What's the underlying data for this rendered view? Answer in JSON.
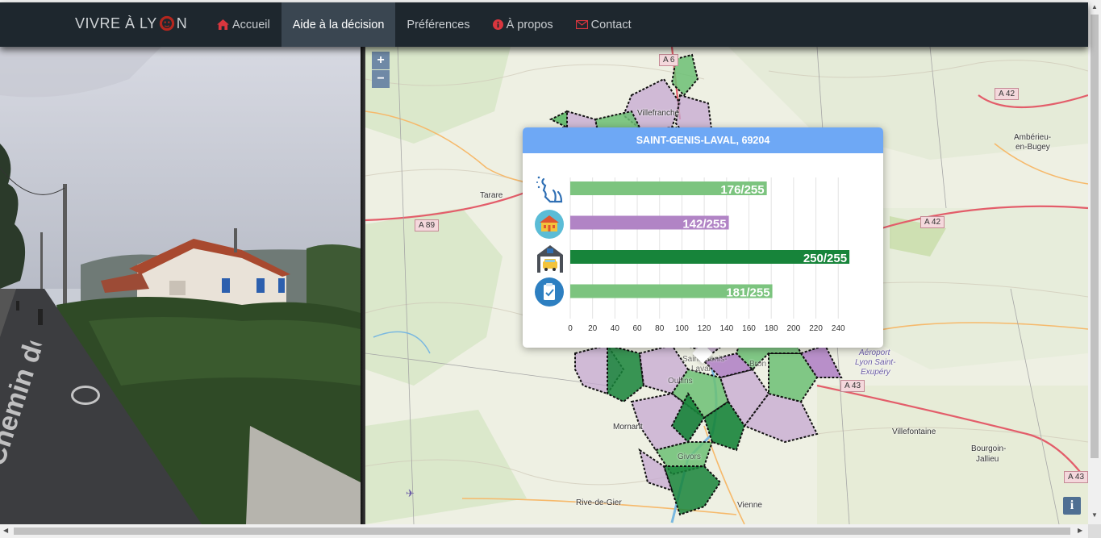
{
  "navbar": {
    "brand_prefix": "VIVRE À LY",
    "brand_suffix": "N",
    "items": [
      {
        "label": "Accueil",
        "icon": "home-icon",
        "active": false
      },
      {
        "label": "Aide à la décision",
        "icon": "",
        "active": true
      },
      {
        "label": "Préférences",
        "icon": "",
        "active": false
      },
      {
        "label": "À propos",
        "icon": "info-circle-icon",
        "active": false
      },
      {
        "label": "Contact",
        "icon": "envelope-icon",
        "active": false
      }
    ]
  },
  "streetview": {
    "street_sign": "Chemin de ..."
  },
  "map": {
    "zoom_in": "+",
    "zoom_out": "−",
    "info_button": "i",
    "labels": {
      "tarare": "Tarare",
      "villefranche": "Villefranche",
      "amberieu1": "Ambérieu-",
      "amberieu2": "en-Bugey",
      "mornant": "Mornant",
      "villefontaine": "Villefontaine",
      "bourgoin1": "Bourgoin-",
      "bourgoin2": "Jallieu",
      "rive_de_gier": "Rive-de-Gier",
      "vienne": "Vienne",
      "aeroport1": "Aéroport",
      "aeroport2": "Lyon Saint-",
      "aeroport3": "Exupéry",
      "saint_genis": "Saint-Genis-",
      "laval": "Laval",
      "bron": "Bron",
      "givors": "Givors",
      "oullins": "Oullins"
    },
    "roads": {
      "a6": "A 6",
      "a42_top": "A 42",
      "a42_mid": "A 42",
      "a89": "A 89",
      "a43_mid": "A 43",
      "a43_right": "A 43"
    }
  },
  "popup": {
    "title": "SAINT-GENIS-LAVAL, 69204"
  },
  "chart_data": {
    "type": "bar",
    "orientation": "horizontal",
    "categories": [
      "pollution-icon",
      "education-icon",
      "transport-icon",
      "services-icon"
    ],
    "values": [
      176,
      142,
      250,
      181
    ],
    "labels": [
      "176/255",
      "142/255",
      "250/255",
      "181/255"
    ],
    "colors": [
      "#7cc47f",
      "#b184c5",
      "#17843a",
      "#7cc47f"
    ],
    "xlim": [
      0,
      255
    ],
    "xticks": [
      0,
      20,
      40,
      60,
      80,
      100,
      120,
      140,
      160,
      180,
      200,
      220,
      240
    ],
    "grid": true
  },
  "scrollbars": {
    "up": "▲",
    "down": "▼",
    "left": "◀",
    "right": "▶"
  }
}
